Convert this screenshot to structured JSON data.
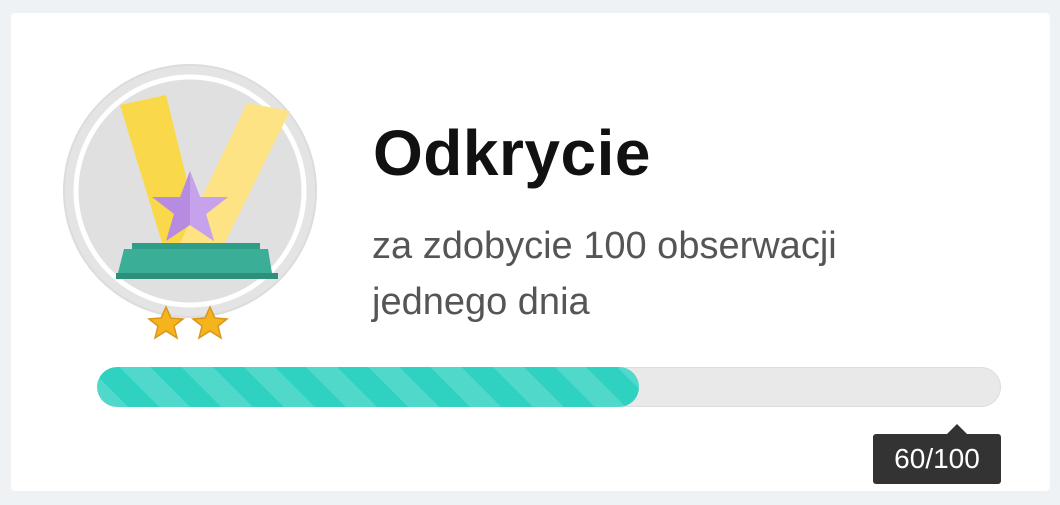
{
  "achievement": {
    "title": "Odkrycie",
    "description": "za zdobycie 100 obserwacji jednego dnia",
    "badge_icon": "spotlight-star-trophy-icon",
    "level_stars": 2
  },
  "progress": {
    "current": 60,
    "max": 100,
    "fraction": 0.6,
    "label": "60/100",
    "fill_color": "#2fd1c1"
  }
}
